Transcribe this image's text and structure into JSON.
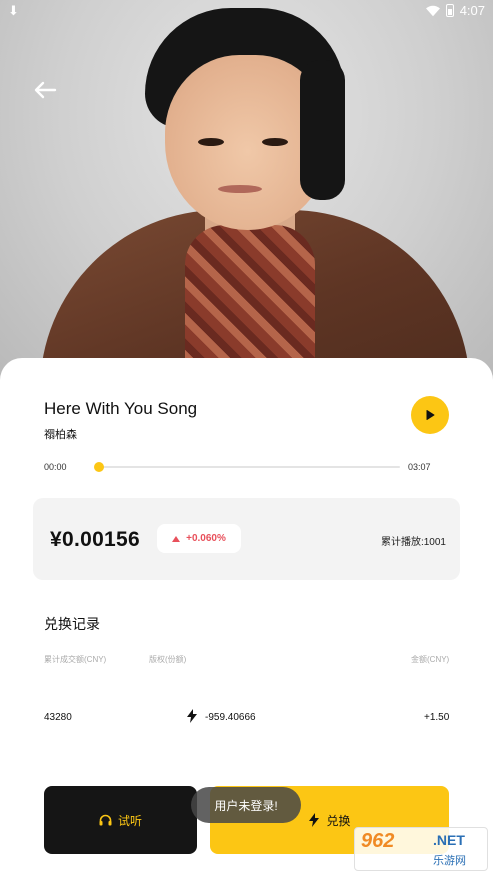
{
  "status_bar": {
    "time": "4:07",
    "download_icon": "download-icon",
    "wifi_icon": "wifi-icon",
    "battery_icon": "battery-icon"
  },
  "song": {
    "title": "Here With You Song",
    "artist": "禤柏森"
  },
  "player": {
    "current_time": "00:00",
    "duration": "03:07",
    "progress": 0
  },
  "price": {
    "value": "¥0.00156",
    "change": "+0.060%",
    "plays": "累计播放:1001"
  },
  "records": {
    "title": "兑换记录",
    "columns": [
      "累计成交额(CNY)",
      "版权(份额)",
      "金额(CNY)"
    ],
    "rows": [
      {
        "total": "43280",
        "shares": "-959.40666",
        "amount": "+1.50"
      }
    ]
  },
  "actions": {
    "listen_label": "试听",
    "exchange_label": "兑换"
  },
  "toast": "用户未登录!",
  "watermark": {
    "num": "962",
    "net": ".NET",
    "cn": "乐游网"
  },
  "colors": {
    "accent": "#fcc614",
    "dark": "#151515",
    "up": "#e8505b"
  }
}
